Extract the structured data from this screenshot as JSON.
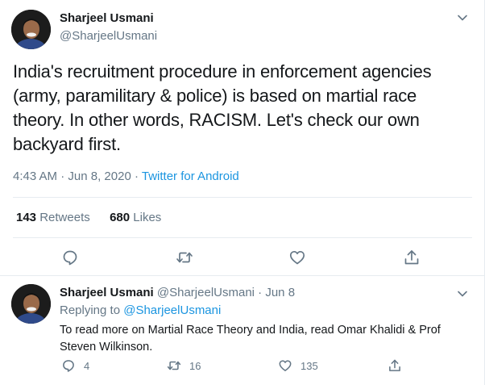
{
  "main_tweet": {
    "author_name": "Sharjeel Usmani",
    "author_handle": "@SharjeelUsmani",
    "text": "India's recruitment procedure in enforcement agencies (army, paramilitary & police) is based on martial race theory. In other words, RACISM. Let's check our own backyard first.",
    "time": "4:43 AM",
    "date": "Jun 8, 2020",
    "separator1": "·",
    "separator2": "·",
    "source": "Twitter for Android",
    "retweet_count": "143",
    "retweet_label": "Retweets",
    "like_count": "680",
    "like_label": "Likes",
    "actions": [
      {
        "icon": "reply-icon"
      },
      {
        "icon": "retweet-icon"
      },
      {
        "icon": "like-icon"
      },
      {
        "icon": "share-icon"
      }
    ]
  },
  "reply_tweet": {
    "author_name": "Sharjeel Usmani",
    "author_handle": "@SharjeelUsmani",
    "separator": "·",
    "date": "Jun 8",
    "replying_prefix": "Replying to",
    "replying_to": "@SharjeelUsmani",
    "text": "To read more on Martial Race Theory and India, read Omar Khalidi & Prof Steven Wilkinson.",
    "reply_count": "4",
    "retweet_count": "16",
    "like_count": "135"
  },
  "colors": {
    "text": "#14171a",
    "secondary": "#657786",
    "link": "#1b95e0",
    "divider": "#e6ecf0"
  }
}
